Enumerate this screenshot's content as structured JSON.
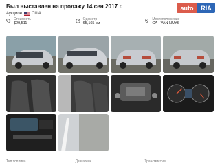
{
  "header": {
    "title": "Был выставлен на продажу 14 сен 2017 г.",
    "auction_label": "Аукцион",
    "country": "США"
  },
  "logo": {
    "part1": "auto",
    "part2": "RIA"
  },
  "stats": [
    {
      "label": "Стоимость",
      "value": "$29,511",
      "icon": "price-tag-icon"
    },
    {
      "label": "Одометр",
      "value": "65,165 км",
      "icon": "odometer-icon"
    },
    {
      "label": "Местоположение",
      "value": "CA - VAN NUYS",
      "icon": "location-pin-icon"
    }
  ],
  "bottom_labels": [
    "Тип топлива",
    "Двигатель",
    "Трансмиссия"
  ],
  "colors": {
    "accent_red": "#db5c4c",
    "accent_blue": "#2e67b6"
  }
}
